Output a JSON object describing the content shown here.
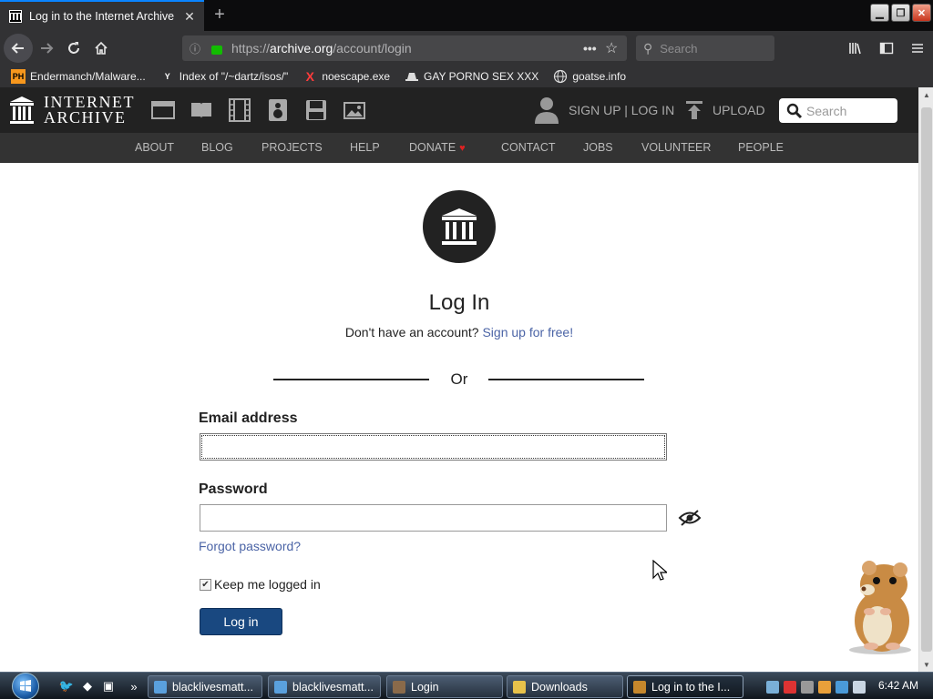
{
  "browser": {
    "tab_title": "Log in to the Internet Archive",
    "tab_close": "✕",
    "new_tab": "+",
    "url_prefix": "https://",
    "url_domain": "archive.org",
    "url_path": "/account/login",
    "search_placeholder": "Search",
    "bookmarks": [
      {
        "label": "Endermanch/Malware...",
        "icon": "PH"
      },
      {
        "label": "Index of \"/~dartz/isos/\"",
        "icon": "Y"
      },
      {
        "label": "noescape.exe",
        "icon": "X"
      },
      {
        "label": "GAY PORNO SEX XXX",
        "icon": "hat"
      },
      {
        "label": "goatse.info",
        "icon": "globe"
      }
    ]
  },
  "ia_header": {
    "brand_line1": "INTERNET",
    "brand_line2": "ARCHIVE",
    "signin": "SIGN UP | LOG IN",
    "upload": "UPLOAD",
    "search_placeholder": "Search",
    "nav": [
      "ABOUT",
      "BLOG",
      "PROJECTS",
      "HELP",
      "DONATE",
      "CONTACT",
      "JOBS",
      "VOLUNTEER",
      "PEOPLE"
    ]
  },
  "login": {
    "title": "Log In",
    "no_account": "Don't have an account?",
    "signup_link": "Sign up for free!",
    "or": "Or",
    "email_label": "Email address",
    "email_value": "",
    "password_label": "Password",
    "password_value": "",
    "forgot": "Forgot password?",
    "keep_logged": "Keep me logged in",
    "keep_checked": true,
    "submit": "Log in"
  },
  "taskbar": {
    "buttons": [
      {
        "label": "blacklivesmatt..."
      },
      {
        "label": "blacklivesmatt..."
      },
      {
        "label": "Login"
      },
      {
        "label": "Downloads"
      },
      {
        "label": "Log in to the I..."
      }
    ],
    "quicklaunch_more": "»",
    "clock": "6:42 AM"
  }
}
